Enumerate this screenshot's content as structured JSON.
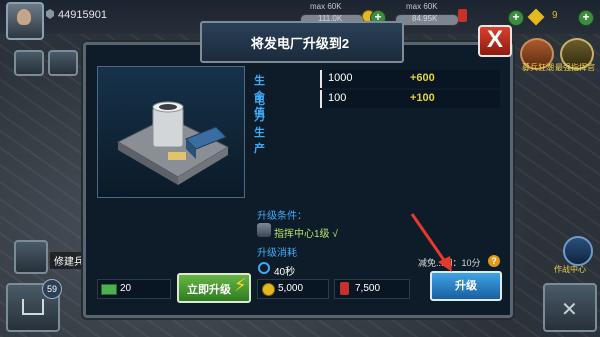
{
  "topbar": {
    "player_power": "44915901",
    "resources": [
      {
        "name": "gold",
        "max": "max 60K",
        "value": "111.0K",
        "color": "#e5b820"
      },
      {
        "name": "fuel",
        "max": "max 60K",
        "value": "84.95K",
        "color": "#c8302a"
      }
    ],
    "gold_currency": "9"
  },
  "dialog": {
    "title": "将发电厂升级到2",
    "close_label": "X",
    "stats": [
      {
        "label": "生命值",
        "base": "1000",
        "increase": "+600"
      },
      {
        "label": "电力生产",
        "base": "100",
        "increase": "+100"
      }
    ],
    "requirements": {
      "label": "升级条件：",
      "items": [
        {
          "text": "指挥中心1级 √"
        }
      ]
    },
    "cost": {
      "label": "升级消耗",
      "time": "40秒",
      "gold": "5,000",
      "fuel": "7,500"
    },
    "cash": "20",
    "instant_label": "立即升级",
    "free_text": "减免...间：10分",
    "upgrade_label": "升级"
  },
  "sidebar": {
    "right_items": [
      {
        "label": "募兵狂潮"
      },
      {
        "label": "最强指挥官"
      },
      {
        "label": "作战中心"
      }
    ],
    "left_items": [
      {
        "label": "修建兵..."
      },
      {
        "badge": "59"
      }
    ]
  }
}
